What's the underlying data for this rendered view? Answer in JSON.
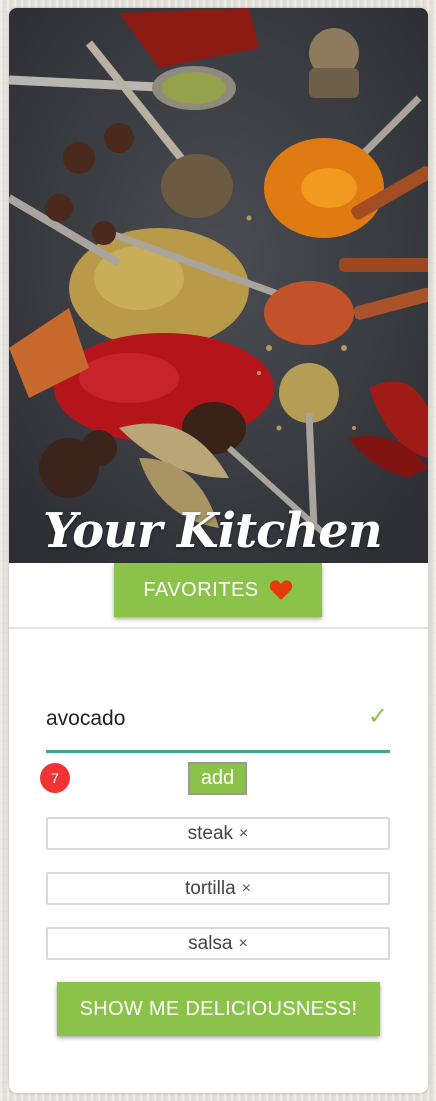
{
  "hero": {
    "title": "Your Kitchen",
    "image_icon": "spices-photo"
  },
  "favorites_button": {
    "label": "FAVORITES",
    "icon": "heart-icon",
    "icon_color": "#e8390e"
  },
  "ingredient_input": {
    "value": "avocado",
    "valid_icon": "check-icon"
  },
  "ingredient_count_badge": "7",
  "add_button": {
    "label": "add"
  },
  "ingredient_chips": [
    {
      "label": "steak",
      "remove": "×"
    },
    {
      "label": "tortilla",
      "remove": "×"
    },
    {
      "label": "salsa",
      "remove": "×"
    }
  ],
  "submit_button": {
    "label": "SHOW ME DELICIOUSNESS!"
  },
  "colors": {
    "accent_green": "#8bc34a",
    "input_underline": "#3aa98e",
    "badge_red": "#f03434"
  }
}
